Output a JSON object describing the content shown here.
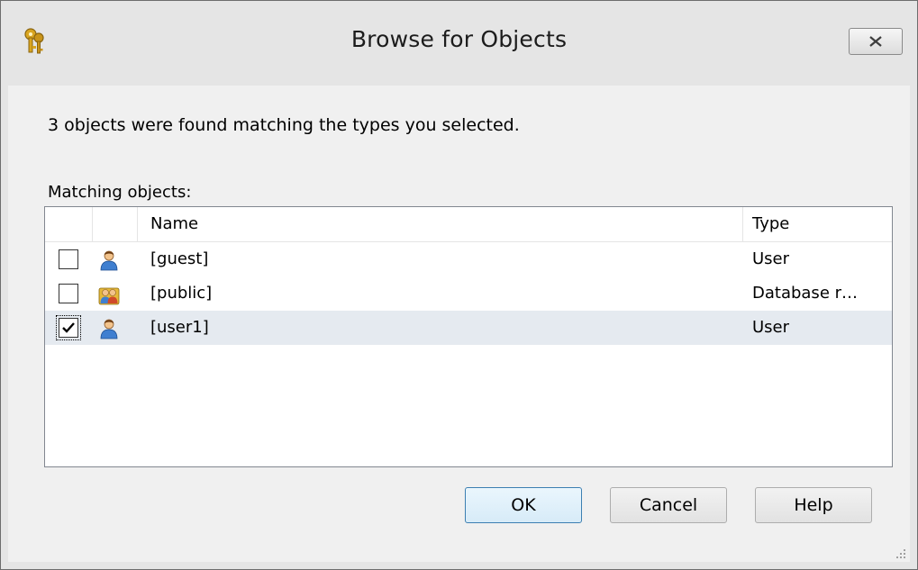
{
  "window": {
    "title": "Browse for Objects",
    "icon": "keys-icon"
  },
  "summary_text": "3 objects were found matching the types you selected.",
  "list": {
    "label": "Matching objects:",
    "columns": {
      "check": "",
      "icon": "",
      "name": "Name",
      "type": "Type"
    },
    "rows": [
      {
        "checked": false,
        "icon": "user-icon",
        "name": "[guest]",
        "type": "User"
      },
      {
        "checked": false,
        "icon": "database-role-icon",
        "name": "[public]",
        "type": "Database r…"
      },
      {
        "checked": true,
        "icon": "user-icon",
        "name": "[user1]",
        "type": "User"
      }
    ]
  },
  "buttons": {
    "ok": "OK",
    "cancel": "Cancel",
    "help": "Help"
  },
  "colors": {
    "selected_row": "#e5eaf0",
    "default_button_border": "#3c7fb1"
  }
}
